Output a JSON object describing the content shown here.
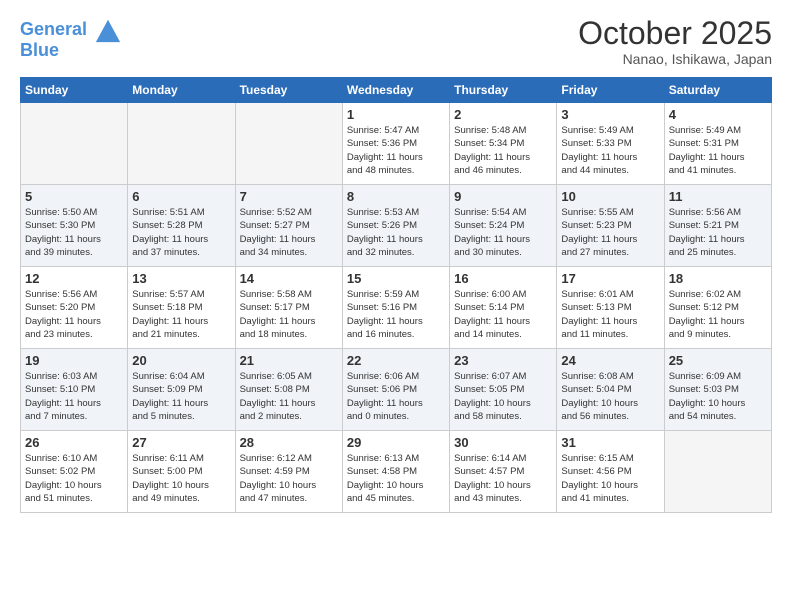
{
  "header": {
    "logo_line1": "General",
    "logo_line2": "Blue",
    "month": "October 2025",
    "location": "Nanao, Ishikawa, Japan"
  },
  "weekdays": [
    "Sunday",
    "Monday",
    "Tuesday",
    "Wednesday",
    "Thursday",
    "Friday",
    "Saturday"
  ],
  "weeks": [
    [
      {
        "day": "",
        "info": ""
      },
      {
        "day": "",
        "info": ""
      },
      {
        "day": "",
        "info": ""
      },
      {
        "day": "1",
        "info": "Sunrise: 5:47 AM\nSunset: 5:36 PM\nDaylight: 11 hours\nand 48 minutes."
      },
      {
        "day": "2",
        "info": "Sunrise: 5:48 AM\nSunset: 5:34 PM\nDaylight: 11 hours\nand 46 minutes."
      },
      {
        "day": "3",
        "info": "Sunrise: 5:49 AM\nSunset: 5:33 PM\nDaylight: 11 hours\nand 44 minutes."
      },
      {
        "day": "4",
        "info": "Sunrise: 5:49 AM\nSunset: 5:31 PM\nDaylight: 11 hours\nand 41 minutes."
      }
    ],
    [
      {
        "day": "5",
        "info": "Sunrise: 5:50 AM\nSunset: 5:30 PM\nDaylight: 11 hours\nand 39 minutes."
      },
      {
        "day": "6",
        "info": "Sunrise: 5:51 AM\nSunset: 5:28 PM\nDaylight: 11 hours\nand 37 minutes."
      },
      {
        "day": "7",
        "info": "Sunrise: 5:52 AM\nSunset: 5:27 PM\nDaylight: 11 hours\nand 34 minutes."
      },
      {
        "day": "8",
        "info": "Sunrise: 5:53 AM\nSunset: 5:26 PM\nDaylight: 11 hours\nand 32 minutes."
      },
      {
        "day": "9",
        "info": "Sunrise: 5:54 AM\nSunset: 5:24 PM\nDaylight: 11 hours\nand 30 minutes."
      },
      {
        "day": "10",
        "info": "Sunrise: 5:55 AM\nSunset: 5:23 PM\nDaylight: 11 hours\nand 27 minutes."
      },
      {
        "day": "11",
        "info": "Sunrise: 5:56 AM\nSunset: 5:21 PM\nDaylight: 11 hours\nand 25 minutes."
      }
    ],
    [
      {
        "day": "12",
        "info": "Sunrise: 5:56 AM\nSunset: 5:20 PM\nDaylight: 11 hours\nand 23 minutes."
      },
      {
        "day": "13",
        "info": "Sunrise: 5:57 AM\nSunset: 5:18 PM\nDaylight: 11 hours\nand 21 minutes."
      },
      {
        "day": "14",
        "info": "Sunrise: 5:58 AM\nSunset: 5:17 PM\nDaylight: 11 hours\nand 18 minutes."
      },
      {
        "day": "15",
        "info": "Sunrise: 5:59 AM\nSunset: 5:16 PM\nDaylight: 11 hours\nand 16 minutes."
      },
      {
        "day": "16",
        "info": "Sunrise: 6:00 AM\nSunset: 5:14 PM\nDaylight: 11 hours\nand 14 minutes."
      },
      {
        "day": "17",
        "info": "Sunrise: 6:01 AM\nSunset: 5:13 PM\nDaylight: 11 hours\nand 11 minutes."
      },
      {
        "day": "18",
        "info": "Sunrise: 6:02 AM\nSunset: 5:12 PM\nDaylight: 11 hours\nand 9 minutes."
      }
    ],
    [
      {
        "day": "19",
        "info": "Sunrise: 6:03 AM\nSunset: 5:10 PM\nDaylight: 11 hours\nand 7 minutes."
      },
      {
        "day": "20",
        "info": "Sunrise: 6:04 AM\nSunset: 5:09 PM\nDaylight: 11 hours\nand 5 minutes."
      },
      {
        "day": "21",
        "info": "Sunrise: 6:05 AM\nSunset: 5:08 PM\nDaylight: 11 hours\nand 2 minutes."
      },
      {
        "day": "22",
        "info": "Sunrise: 6:06 AM\nSunset: 5:06 PM\nDaylight: 11 hours\nand 0 minutes."
      },
      {
        "day": "23",
        "info": "Sunrise: 6:07 AM\nSunset: 5:05 PM\nDaylight: 10 hours\nand 58 minutes."
      },
      {
        "day": "24",
        "info": "Sunrise: 6:08 AM\nSunset: 5:04 PM\nDaylight: 10 hours\nand 56 minutes."
      },
      {
        "day": "25",
        "info": "Sunrise: 6:09 AM\nSunset: 5:03 PM\nDaylight: 10 hours\nand 54 minutes."
      }
    ],
    [
      {
        "day": "26",
        "info": "Sunrise: 6:10 AM\nSunset: 5:02 PM\nDaylight: 10 hours\nand 51 minutes."
      },
      {
        "day": "27",
        "info": "Sunrise: 6:11 AM\nSunset: 5:00 PM\nDaylight: 10 hours\nand 49 minutes."
      },
      {
        "day": "28",
        "info": "Sunrise: 6:12 AM\nSunset: 4:59 PM\nDaylight: 10 hours\nand 47 minutes."
      },
      {
        "day": "29",
        "info": "Sunrise: 6:13 AM\nSunset: 4:58 PM\nDaylight: 10 hours\nand 45 minutes."
      },
      {
        "day": "30",
        "info": "Sunrise: 6:14 AM\nSunset: 4:57 PM\nDaylight: 10 hours\nand 43 minutes."
      },
      {
        "day": "31",
        "info": "Sunrise: 6:15 AM\nSunset: 4:56 PM\nDaylight: 10 hours\nand 41 minutes."
      },
      {
        "day": "",
        "info": ""
      }
    ]
  ]
}
